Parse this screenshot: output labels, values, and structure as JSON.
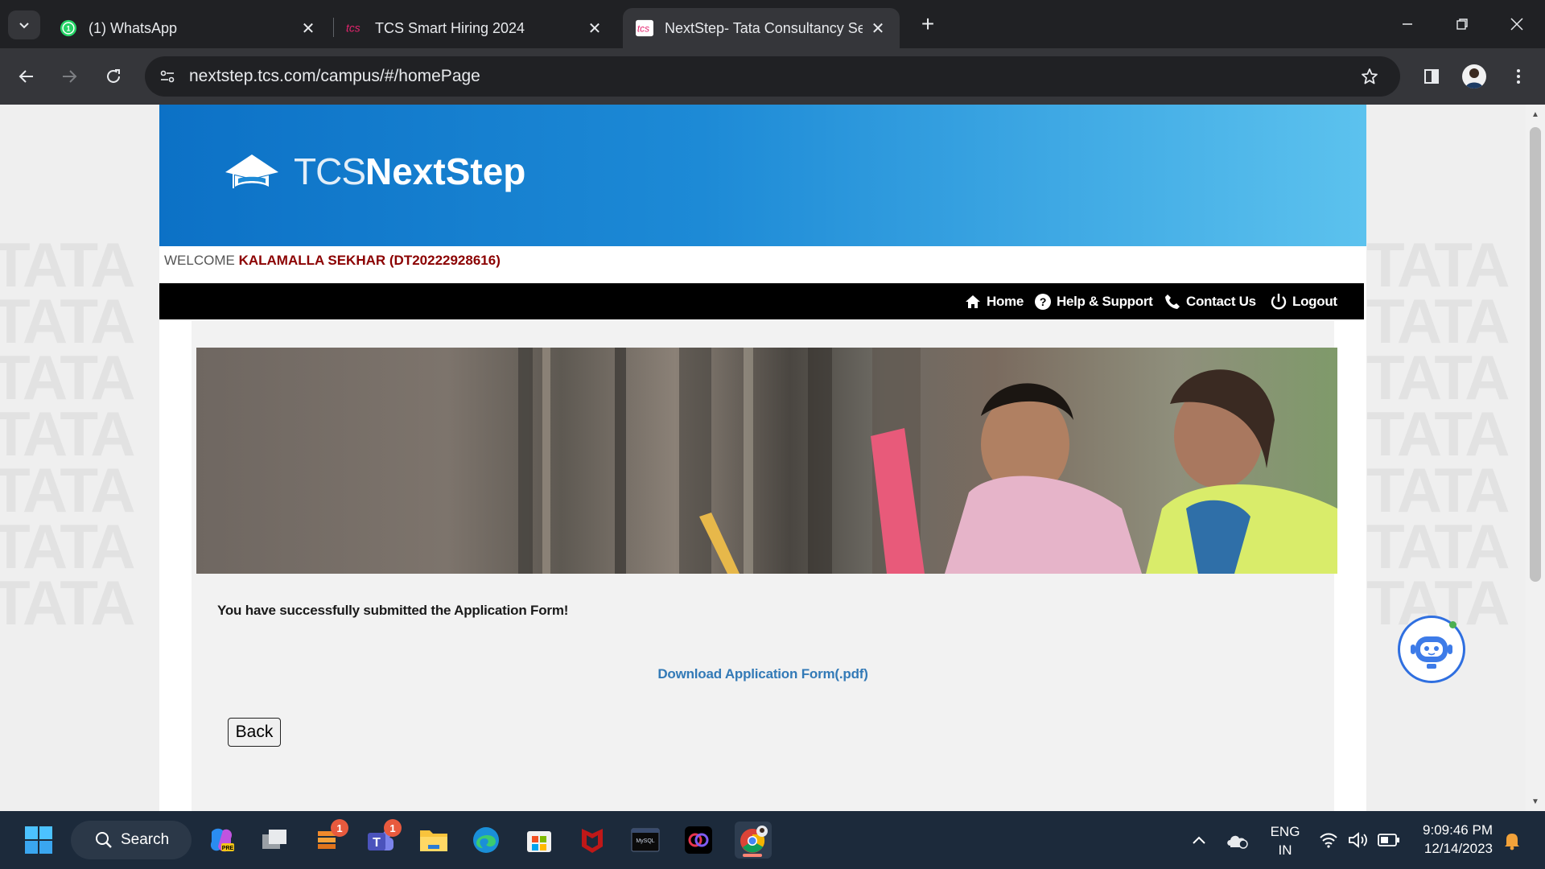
{
  "browser": {
    "tabs": [
      {
        "title": "(1) WhatsApp",
        "icon": "whatsapp-icon",
        "active": false
      },
      {
        "title": "TCS Smart Hiring 2024",
        "icon": "tcs-icon",
        "active": false
      },
      {
        "title": "NextStep- Tata Consultancy Ser",
        "icon": "tcs-nextstep-icon",
        "active": true
      }
    ],
    "url": "nextstep.tcs.com/campus/#/homePage"
  },
  "page": {
    "logo": {
      "prefix": "TCS",
      "name": "NextStep"
    },
    "welcome": {
      "label": "WELCOME",
      "user": "KALAMALLA SEKHAR (DT20222928616)"
    },
    "nav": {
      "home": "Home",
      "help": "Help & Support",
      "contact": "Contact Us",
      "logout": "Logout"
    },
    "background_watermark": "TATA",
    "success_message": "You have successfully submitted the Application Form!",
    "download_link": "Download Application Form(.pdf)",
    "back_button": "Back"
  },
  "taskbar": {
    "search_label": "Search",
    "badges": {
      "app_badge_1": "1",
      "teams_badge": "1"
    },
    "language": {
      "line1": "ENG",
      "line2": "IN"
    },
    "time": "9:09:46 PM",
    "date": "12/14/2023"
  },
  "colors": {
    "banner_start": "#0c71c6",
    "banner_end": "#5cc2ee",
    "welcome_name": "#8b0000",
    "link": "#337ab7",
    "navbar": "#000000"
  }
}
